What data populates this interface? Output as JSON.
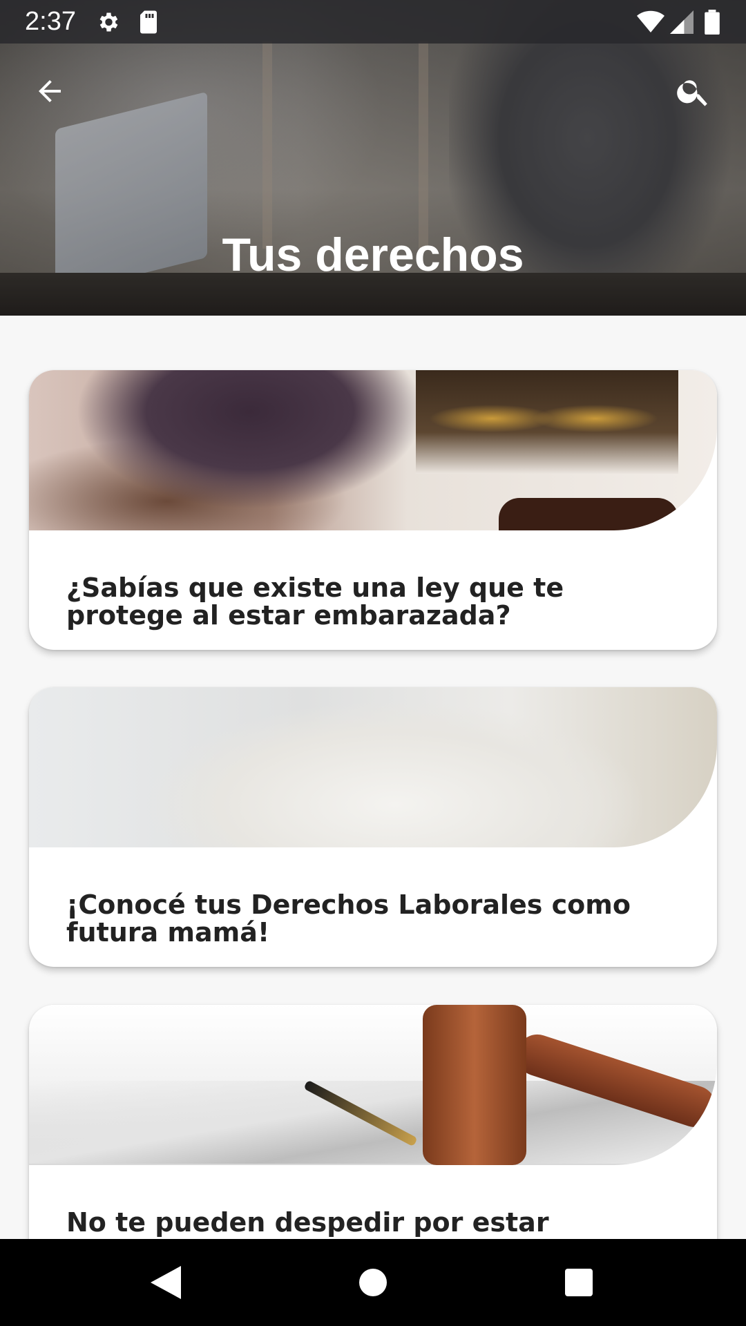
{
  "status_bar": {
    "time": "2:37",
    "icons": [
      "gear-icon",
      "sd-card-icon",
      "wifi-icon",
      "signal-icon",
      "battery-icon"
    ]
  },
  "header": {
    "title": "Tus derechos",
    "back_icon": "arrow-back-icon",
    "search_icon": "search-icon"
  },
  "cards": [
    {
      "title": "¿Sabías que existe una ley que te protege al estar embarazada?"
    },
    {
      "title": "¡Conocé tus Derechos Laborales como futura mamá!"
    },
    {
      "title": "No te pueden despedir por estar"
    }
  ],
  "nav_bar": {
    "icons": [
      "back-triangle-icon",
      "home-circle-icon",
      "recents-square-icon"
    ]
  },
  "colors": {
    "background": "#f7f7f7",
    "card": "#ffffff",
    "title_text": "#222222"
  }
}
